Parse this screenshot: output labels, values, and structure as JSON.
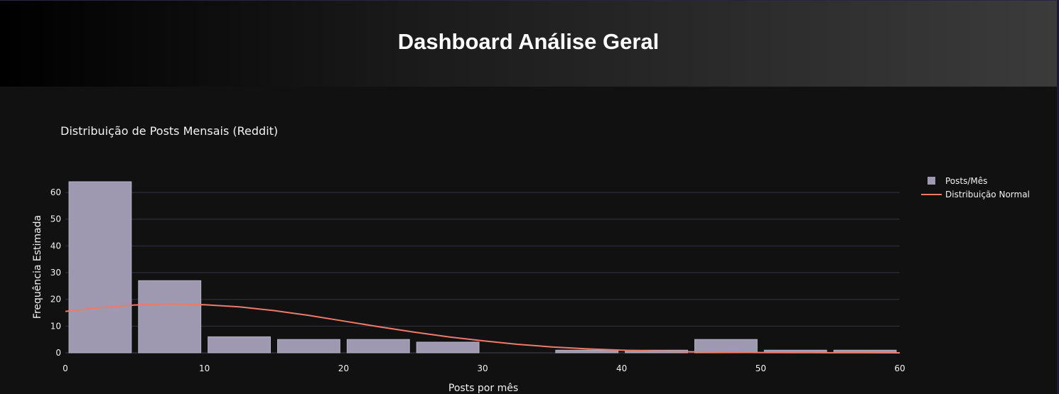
{
  "header": {
    "title": "Dashboard Análise Geral"
  },
  "colors": {
    "bar": "#9e99b0",
    "bar_outline": "#b6b2c4",
    "curve": "#ef7a68",
    "grid": "#333344",
    "background": "#111111"
  },
  "chart_data": {
    "type": "bar",
    "title": "Distribuição de Posts Mensais (Reddit)",
    "xlabel": "Posts por mês",
    "ylabel": "Frequência Estimada",
    "xlim": [
      0,
      60
    ],
    "ylim": [
      0,
      64
    ],
    "xticks": [
      0,
      10,
      20,
      30,
      40,
      50,
      60
    ],
    "yticks": [
      0,
      10,
      20,
      30,
      40,
      50,
      60
    ],
    "grid": true,
    "legend_position": "top-right",
    "bins": [
      {
        "x0": 0,
        "x1": 5,
        "value": 64
      },
      {
        "x0": 5,
        "x1": 10,
        "value": 27
      },
      {
        "x0": 10,
        "x1": 15,
        "value": 6
      },
      {
        "x0": 15,
        "x1": 20,
        "value": 5
      },
      {
        "x0": 20,
        "x1": 25,
        "value": 5
      },
      {
        "x0": 25,
        "x1": 30,
        "value": 4
      },
      {
        "x0": 30,
        "x1": 35,
        "value": 0
      },
      {
        "x0": 35,
        "x1": 40,
        "value": 1
      },
      {
        "x0": 40,
        "x1": 45,
        "value": 1
      },
      {
        "x0": 45,
        "x1": 50,
        "value": 5
      },
      {
        "x0": 50,
        "x1": 55,
        "value": 1
      },
      {
        "x0": 55,
        "x1": 60,
        "value": 1
      }
    ],
    "series": [
      {
        "name": "Posts/Mês",
        "kind": "bar"
      },
      {
        "name": "Distribuição Normal",
        "kind": "line",
        "x": [
          0,
          2.5,
          5,
          7.5,
          10,
          12.5,
          15,
          17.5,
          20,
          22.5,
          25,
          27.5,
          30,
          32.5,
          35,
          37.5,
          40,
          42.5,
          45,
          47.5,
          50,
          52.5,
          55,
          57.5,
          60
        ],
        "y": [
          15.5,
          16.9,
          17.9,
          18.3,
          18.0,
          17.2,
          15.8,
          14.0,
          11.9,
          9.8,
          7.8,
          6.0,
          4.5,
          3.2,
          2.2,
          1.5,
          1.0,
          0.6,
          0.4,
          0.2,
          0.1,
          0.07,
          0.04,
          0.02,
          0.01
        ]
      }
    ]
  }
}
